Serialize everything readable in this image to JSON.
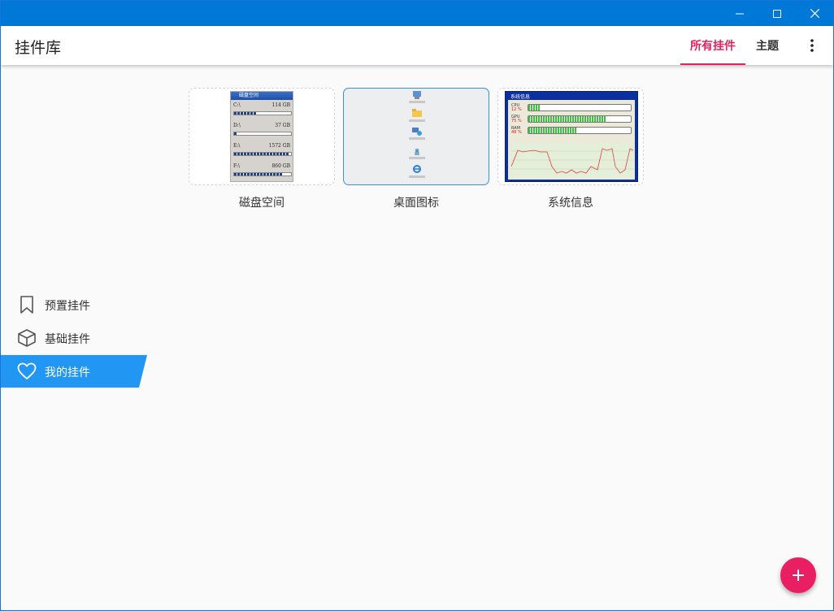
{
  "app": {
    "title": "挂件库"
  },
  "tabs": [
    {
      "label": "所有挂件",
      "active": true
    },
    {
      "label": "主题",
      "active": false
    }
  ],
  "widgets": [
    {
      "label": "磁盘空间",
      "selected": false,
      "preview": {
        "title": "磁盘空间",
        "drives": [
          {
            "name": "C:\\",
            "size": "114 GB",
            "fill": 0.38
          },
          {
            "name": "D:\\",
            "size": "37 GB",
            "fill": 0.04
          },
          {
            "name": "E:\\",
            "size": "1572 GB",
            "fill": 0.95
          },
          {
            "name": "F:\\",
            "size": "860 GB",
            "fill": 0.85
          }
        ]
      }
    },
    {
      "label": "桌面图标",
      "selected": true,
      "preview": {
        "icon_names": [
          "computer-icon",
          "folder-icon",
          "network-icon",
          "recycle-icon",
          "ie-icon"
        ]
      }
    },
    {
      "label": "系统信息",
      "selected": false,
      "preview": {
        "title": "系统信息",
        "rows": [
          {
            "label": "CPU",
            "value": "12 %",
            "fill": 0.12
          },
          {
            "label": "GPU",
            "value": "75 %",
            "fill": 0.75
          },
          {
            "label": "RAM",
            "value": "48 %",
            "fill": 0.48
          }
        ]
      }
    }
  ],
  "sidebar": {
    "items": [
      {
        "label": "预置挂件",
        "icon": "bookmark-icon",
        "active": false
      },
      {
        "label": "基础挂件",
        "icon": "cube-icon",
        "active": false
      },
      {
        "label": "我的挂件",
        "icon": "heart-icon",
        "active": true
      }
    ]
  },
  "colors": {
    "titlebar": "#0078d7",
    "accent": "#e0245e",
    "fab": "#e91e63",
    "sidebar_active": "#2196f3"
  }
}
